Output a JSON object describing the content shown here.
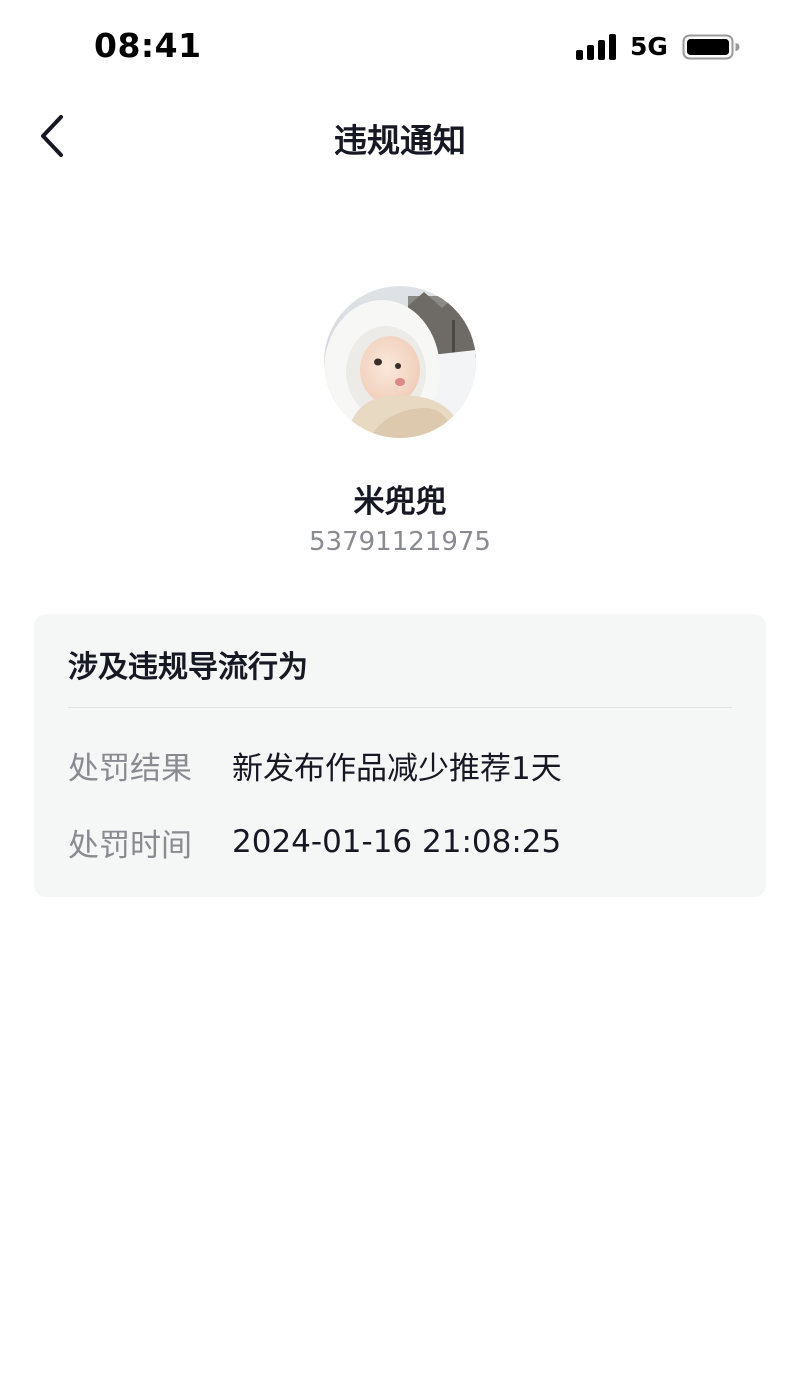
{
  "status_bar": {
    "time": "08:41",
    "network": "5G",
    "icons": [
      "signal-icon",
      "battery-icon"
    ]
  },
  "nav": {
    "title": "违规通知",
    "back_icon": "chevron-left-icon"
  },
  "profile": {
    "name": "米兜兜",
    "id": "53791121975"
  },
  "notice": {
    "title": "涉及违规导流行为",
    "rows": [
      {
        "label": "处罚结果",
        "value": "新发布作品减少推荐1天"
      },
      {
        "label": "处罚时间",
        "value": "2024-01-16 21:08:25"
      }
    ]
  },
  "colors": {
    "text_primary": "#161823",
    "text_secondary": "#8a8b91",
    "card_bg": "#f5f6f6"
  }
}
